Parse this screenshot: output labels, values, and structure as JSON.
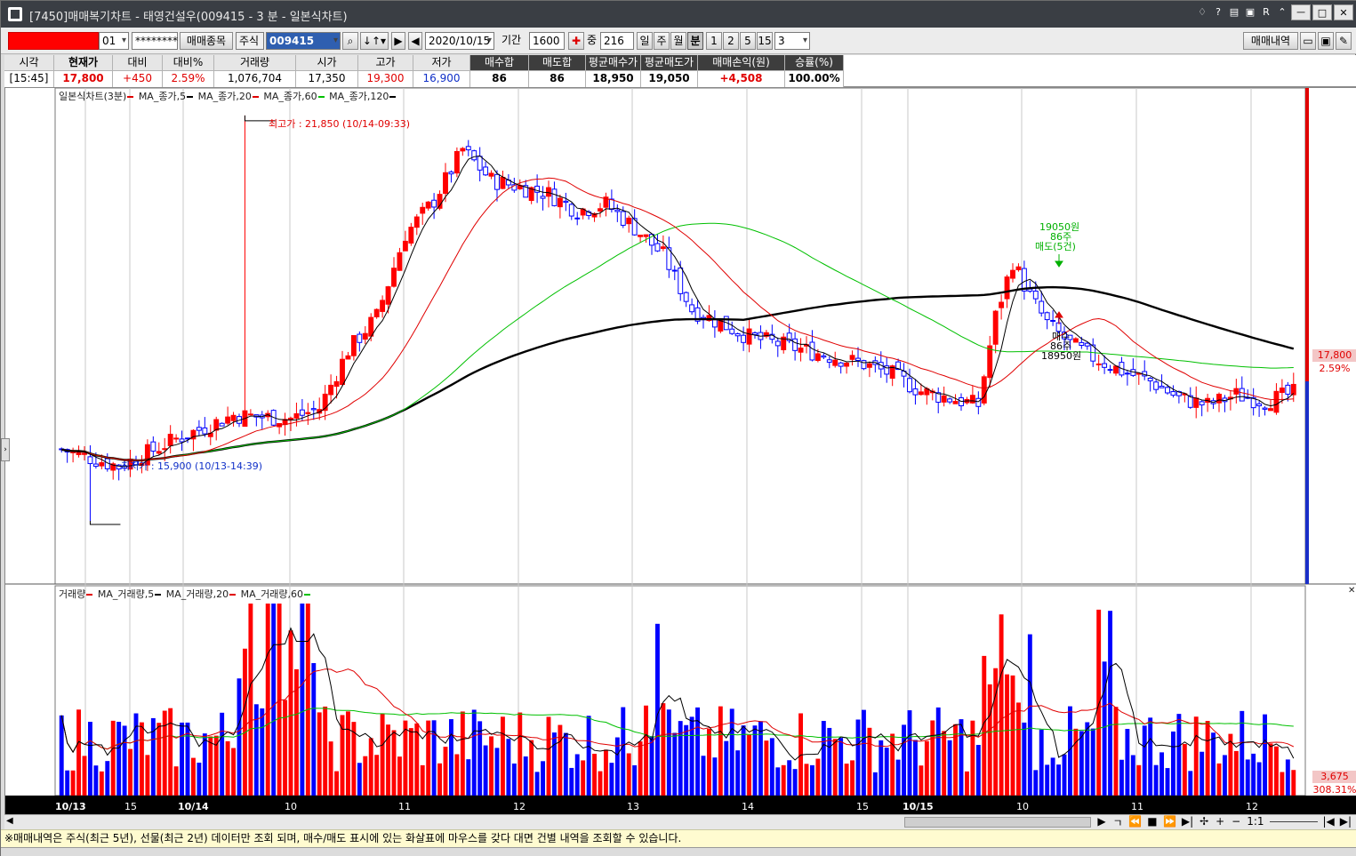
{
  "window": {
    "title": "[7450]매매복기차트 - 태영건설우(009415 - 3 분 - 일본식차트)",
    "ctrl_icons": [
      "?",
      "R",
      "ㅡ"
    ]
  },
  "toolbar": {
    "account_suffix": "01",
    "password_mask": "********",
    "trade_items_button": "매매종목",
    "market_select": "주식",
    "code_value": "009415",
    "date_value": "2020/10/15",
    "period_label": "기간",
    "period_value": "1600",
    "count_label": "중",
    "count_value": "216",
    "period_buttons": [
      "일",
      "주",
      "월",
      "분"
    ],
    "active_period": "분",
    "minute_buttons": [
      "1",
      "2",
      "5",
      "15"
    ],
    "minute_select": "3",
    "history_button": "매매내역"
  },
  "quote": {
    "headers": [
      "시각",
      "현재가",
      "대비",
      "대비%",
      "거래량",
      "시가",
      "고가",
      "저가",
      "매수합",
      "매도합",
      "평균매수가",
      "평균매도가",
      "매매손익(원)",
      "승률(%)"
    ],
    "values": [
      "[15:45]",
      "17,800",
      "+450",
      "2.59%",
      "1,076,704",
      "17,350",
      "19,300",
      "16,900",
      "86",
      "86",
      "18,950",
      "19,050",
      "+4,508",
      "100.00%"
    ]
  },
  "legend_price": {
    "title": "일본식차트(3분)",
    "items": [
      "MA_종가,5",
      "MA_종가,20",
      "MA_종가,60",
      "MA_종가,120"
    ],
    "colors": [
      "#e00000",
      "#000000",
      "#e00000",
      "#00c000",
      "#000000"
    ]
  },
  "legend_volume": {
    "title": "거래량",
    "items": [
      "MA_거래량,5",
      "MA_거래량,20",
      "MA_거래량,60"
    ],
    "colors": [
      "#e00000",
      "#000000",
      "#e00000",
      "#00c000"
    ]
  },
  "annotations": {
    "high": "최고가 : 21,850 (10/14-09:33)",
    "low": "최저가 : 15,900 (10/13-14:39)",
    "sell_price": "19050원",
    "sell_qty": "86주",
    "sell_label": "매도(5건)",
    "buy_label": "매수",
    "buy_qty": "86주",
    "buy_price": "18950원",
    "price_tag": "17,800",
    "pct_tag": "2.59%",
    "vol_tag": "3,675",
    "vol_pct_tag": "308.31%"
  },
  "x_axis": {
    "labels": [
      "10/13",
      "15",
      "10/14",
      "10",
      "11",
      "12",
      "13",
      "14",
      "15",
      "10/15",
      "10",
      "11",
      "12"
    ],
    "bold": [
      true,
      false,
      true,
      false,
      false,
      false,
      false,
      false,
      false,
      true,
      false,
      false,
      false
    ]
  },
  "chart_data": {
    "type": "candlestick",
    "symbol": "009415",
    "high": 21850,
    "low": 15900,
    "close": 17800,
    "ylim": [
      15000,
      22200
    ],
    "series": [
      {
        "name": "MA_종가,5"
      },
      {
        "name": "MA_종가,20"
      },
      {
        "name": "MA_종가,60"
      },
      {
        "name": "MA_종가,120"
      }
    ]
  },
  "status_text": "※매매내역은 주식(최근 5년), 선물(최근 2년) 데이터만 조회 되며, 매수/매도 표시에 있는 화살표에 마우스를 갖다 대면 건별 내역을 조회할 수 있습니다.",
  "colors": {
    "up": "#ff0000",
    "down": "#0000ff",
    "ma5": "#000000",
    "ma20": "#e00000",
    "ma60": "#00c000",
    "ma120": "#000000"
  }
}
